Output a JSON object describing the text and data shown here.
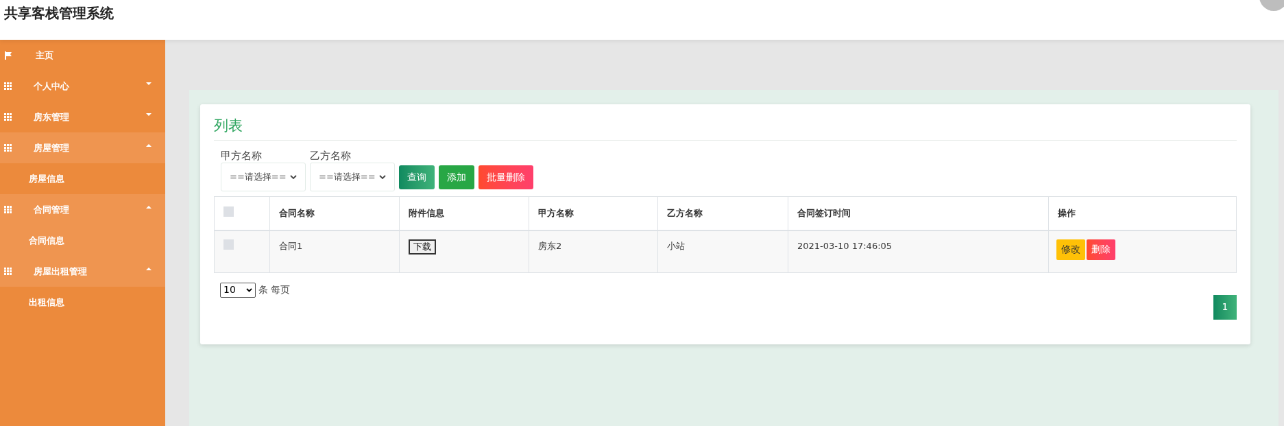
{
  "header": {
    "title": "共享客栈管理系统"
  },
  "sidebar": {
    "items": [
      {
        "kind": "link",
        "label": "主页",
        "expanded": false
      },
      {
        "kind": "group",
        "label": "个人中心",
        "expanded": false
      },
      {
        "kind": "group",
        "label": "房东管理",
        "expanded": false
      },
      {
        "kind": "group",
        "label": "房屋管理",
        "expanded": true,
        "children": [
          {
            "label": "房屋信息",
            "selected": false
          }
        ]
      },
      {
        "kind": "group",
        "label": "合同管理",
        "expanded": true,
        "children": [
          {
            "label": "合同信息",
            "selected": true
          }
        ]
      },
      {
        "kind": "group",
        "label": "房屋出租管理",
        "expanded": true,
        "children": [
          {
            "label": "出租信息",
            "selected": false
          }
        ]
      }
    ]
  },
  "card": {
    "title": "列表",
    "filters": [
      {
        "label": "甲方名称",
        "value": "==请选择=="
      },
      {
        "label": "乙方名称",
        "value": "==请选择=="
      }
    ],
    "buttons": [
      {
        "kind": "search",
        "label": "查询"
      },
      {
        "kind": "add",
        "label": "添加"
      },
      {
        "kind": "bulk_delete",
        "label": "批量删除"
      }
    ],
    "table": {
      "select_all_checked": false,
      "columns": [
        "合同名称",
        "附件信息",
        "甲方名称",
        "乙方名称",
        "合同签订时间",
        "操作"
      ],
      "rows": [
        {
          "checked": false,
          "name": "合同1",
          "attachment": "下载",
          "party_a": "房东2",
          "party_b": "小站",
          "signed_at": "2021-03-10 17:46:05",
          "actions": [
            {
              "kind": "edit",
              "label": "修改"
            },
            {
              "kind": "delete",
              "label": "删除"
            }
          ]
        }
      ]
    },
    "page_size": {
      "value": "10",
      "suffix": "条 每页"
    },
    "pagination": [
      {
        "label": "1",
        "selected": true
      }
    ]
  }
}
